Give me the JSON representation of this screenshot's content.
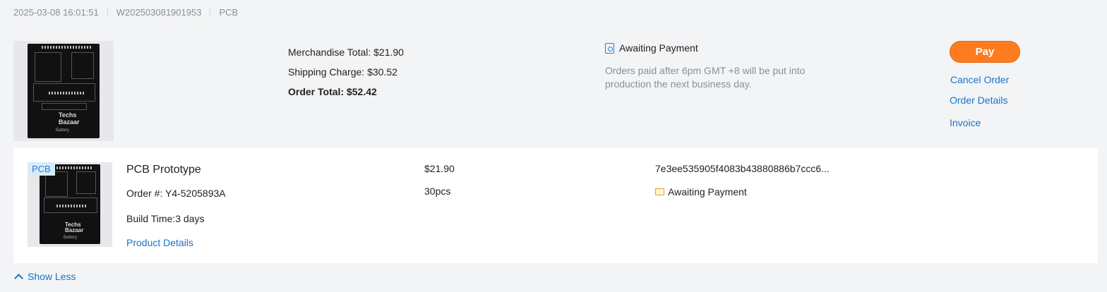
{
  "order_meta": {
    "datetime": "2025-03-08 16:01:51",
    "order_id": "W202503081901953",
    "category": "PCB"
  },
  "board_label": {
    "logo_line1": "Techs",
    "logo_line2": "Bazaar",
    "sub": "Battery"
  },
  "summary": {
    "merchandise_total": "Merchandise Total: $21.90",
    "shipping_charge": "Shipping Charge: $30.52",
    "order_total": "Order Total: $52.42"
  },
  "status": {
    "label": "Awaiting Payment",
    "note": "Orders paid after 6pm GMT +8 will be put into production the next business day."
  },
  "actions": {
    "pay": "Pay",
    "cancel": "Cancel Order",
    "details": "Order Details",
    "invoice": "Invoice"
  },
  "item": {
    "tag": "PCB",
    "title": "PCB Prototype",
    "order_number": "Order #: Y4-5205893A",
    "build_time": "Build Time:3 days",
    "product_details": "Product Details",
    "price": "$21.90",
    "quantity": "30pcs",
    "hash": "7e3ee535905f4083b43880886b7ccc6...",
    "status": "Awaiting Payment"
  },
  "footer": {
    "show_less": "Show Less"
  },
  "colors": {
    "accent": "#ff7b20",
    "link": "#1a73c7",
    "muted": "#8a8f99"
  }
}
